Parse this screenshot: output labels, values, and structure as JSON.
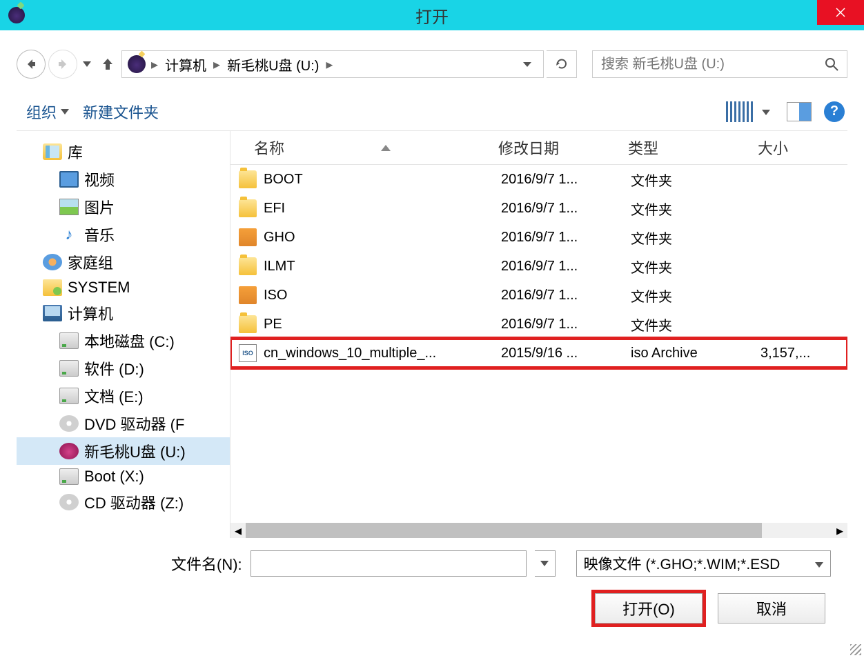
{
  "titlebar": {
    "title": "打开"
  },
  "breadcrumb": {
    "seg1": "计算机",
    "seg2": "新毛桃U盘 (U:)"
  },
  "search": {
    "placeholder": "搜索 新毛桃U盘 (U:)"
  },
  "toolbar": {
    "organize": "组织",
    "newfolder": "新建文件夹"
  },
  "tree": {
    "library": "库",
    "video": "视频",
    "pictures": "图片",
    "music": "音乐",
    "homegroup": "家庭组",
    "system": "SYSTEM",
    "computer": "计算机",
    "drive_c": "本地磁盘 (C:)",
    "drive_d": "软件 (D:)",
    "drive_e": "文档 (E:)",
    "dvd": "DVD 驱动器 (F",
    "udisk": "新毛桃U盘 (U:)",
    "boot": "Boot (X:)",
    "cd_z": "CD 驱动器 (Z:)"
  },
  "columns": {
    "name": "名称",
    "date": "修改日期",
    "type": "类型",
    "size": "大小"
  },
  "files": [
    {
      "name": "BOOT",
      "date": "2016/9/7 1...",
      "type": "文件夹",
      "size": "",
      "icon": "folder"
    },
    {
      "name": "EFI",
      "date": "2016/9/7 1...",
      "type": "文件夹",
      "size": "",
      "icon": "folder"
    },
    {
      "name": "GHO",
      "date": "2016/9/7 1...",
      "type": "文件夹",
      "size": "",
      "icon": "folder-open"
    },
    {
      "name": "ILMT",
      "date": "2016/9/7 1...",
      "type": "文件夹",
      "size": "",
      "icon": "folder"
    },
    {
      "name": "ISO",
      "date": "2016/9/7 1...",
      "type": "文件夹",
      "size": "",
      "icon": "folder-open"
    },
    {
      "name": "PE",
      "date": "2016/9/7 1...",
      "type": "文件夹",
      "size": "",
      "icon": "folder"
    },
    {
      "name": "cn_windows_10_multiple_...",
      "date": "2015/9/16 ...",
      "type": "iso Archive",
      "size": "3,157,...",
      "icon": "iso",
      "highlighted": true
    }
  ],
  "filename": {
    "label": "文件名(N):",
    "value": ""
  },
  "filetype": {
    "label": "映像文件 (*.GHO;*.WIM;*.ESD"
  },
  "buttons": {
    "open": "打开(O)",
    "cancel": "取消"
  }
}
